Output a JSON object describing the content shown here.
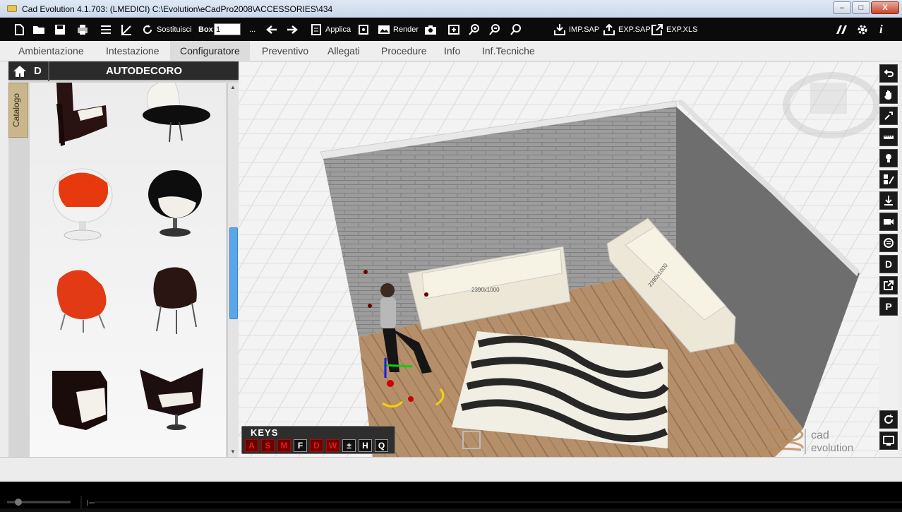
{
  "window": {
    "title": "Cad Evolution 4.1.703: (LMEDICI)  C:\\Evolution\\eCadPro2008\\ACCESSORIES\\434",
    "min_label": "–",
    "max_label": "□",
    "close_label": "X"
  },
  "toolbar": {
    "replace_label": "Sostituisci",
    "box_label": "Box",
    "box_value": "1",
    "ellipsis": "...",
    "apply_label": "Applica",
    "render_label": "Render",
    "imp_sap_label": "IMP.SAP",
    "exp_sap_label": "EXP.SAP",
    "exp_xls_label": "EXP.XLS",
    "info_label": "i"
  },
  "menu": {
    "items": [
      "Ambientazione",
      "Intestazione",
      "Configuratore",
      "Preventivo",
      "Allegati",
      "Procedure",
      "Info",
      "Inf.Tecniche"
    ],
    "active_index": 2
  },
  "panel": {
    "home_icon": "home-icon",
    "d_label": "D",
    "title": "AUTODECORO",
    "catalog_tab": "Catalogo"
  },
  "viewport": {
    "sofa_label_1": "2390x1000",
    "sofa_label_2": "2390x1000",
    "keys_label": "KEYS",
    "keys": [
      "A",
      "S",
      "M",
      "F",
      "D",
      "W",
      "±",
      "H",
      "Q"
    ],
    "logo_top": "cad",
    "logo_bottom": "evolution"
  },
  "righttools": {
    "d_label": "D",
    "p_label": "P"
  },
  "colors": {
    "accent_blue": "#5aa7e8",
    "toolbar_bg": "#0b0b0b",
    "key_red": "#e51c1c"
  }
}
